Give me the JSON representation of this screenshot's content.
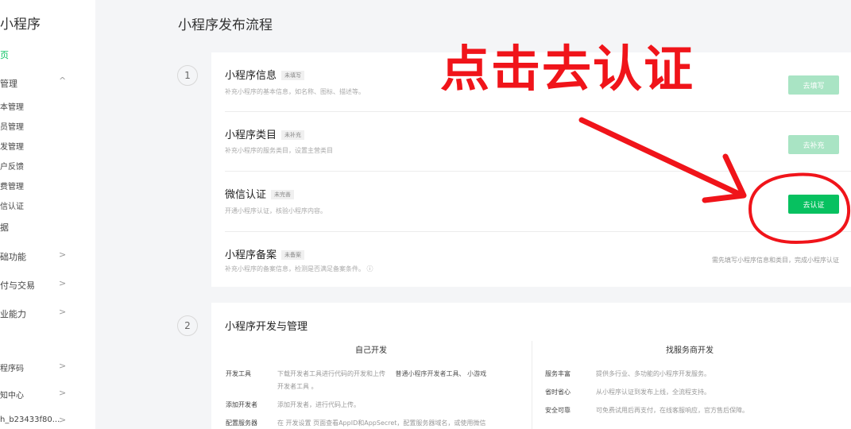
{
  "sidebar": {
    "title": "小程序",
    "items": [
      {
        "label": "页",
        "chev": ""
      },
      {
        "label": "管理",
        "chev": "^"
      },
      {
        "label": "本管理",
        "chev": ""
      },
      {
        "label": "员管理",
        "chev": ""
      },
      {
        "label": "发管理",
        "chev": ""
      },
      {
        "label": "户反馈",
        "chev": ""
      },
      {
        "label": "费管理",
        "chev": ""
      },
      {
        "label": "信认证",
        "chev": ""
      },
      {
        "label": "据",
        "chev": ""
      },
      {
        "label": "础功能",
        "chev": ">"
      },
      {
        "label": "付与交易",
        "chev": ">"
      },
      {
        "label": "业能力",
        "chev": ">"
      },
      {
        "label": "程序码",
        "chev": ">"
      },
      {
        "label": "知中心",
        "chev": ">"
      },
      {
        "label": "h_b23433f80...",
        "chev": ">"
      }
    ]
  },
  "page": {
    "title": "小程序发布流程"
  },
  "steps": [
    "1",
    "2"
  ],
  "publish_rows": [
    {
      "title": "小程序信息",
      "badge": "未填写",
      "desc": "补充小程序的基本信息，如名称、图标、描述等。",
      "action": "去填写"
    },
    {
      "title": "小程序类目",
      "badge": "未补充",
      "desc": "补充小程序的服务类目，设置主营类目",
      "action": "去补充"
    },
    {
      "title": "微信认证",
      "badge": "未完善",
      "desc": "开通小程序认证，核验小程序内容。",
      "action": "去认证"
    },
    {
      "title": "小程序备案",
      "badge": "未备案",
      "desc": "补充小程序的备案信息，检测是否满足备案条件。",
      "hint_icon": "ⓘ",
      "hint": "需先填写小程序信息和类目，完成小程序认证"
    }
  ],
  "dev": {
    "title": "小程序开发与管理",
    "self": {
      "heading": "自己开发",
      "items": [
        {
          "key": "开发工具",
          "val": "下载开发者工具进行代码的开发和上传",
          "link": "普通小程序开发者工具、 小游戏",
          "line2": "开发者工具 。"
        },
        {
          "key": "添加开发者",
          "val": "添加开发者，进行代码上传。"
        },
        {
          "key": "配置服务器",
          "val": "在 开发设置 页面查看AppID和AppSecret，配置服务器域名，或使用微信"
        }
      ]
    },
    "vendor": {
      "heading": "找服务商开发",
      "items": [
        {
          "key": "服务丰富",
          "val": "提供多行业、多功能的小程序开发服务。"
        },
        {
          "key": "省时省心",
          "val": "从小程序认证到发布上线，全流程支持。"
        },
        {
          "key": "安全可靠",
          "val": "可免费试用后再支付，在线客服响应，官方售后保障。"
        }
      ]
    }
  },
  "annotation": {
    "text": "点击去认证",
    "color": "#f0141a"
  },
  "colors": {
    "primary": "#07c160",
    "disabled": "#a9e4c4"
  }
}
